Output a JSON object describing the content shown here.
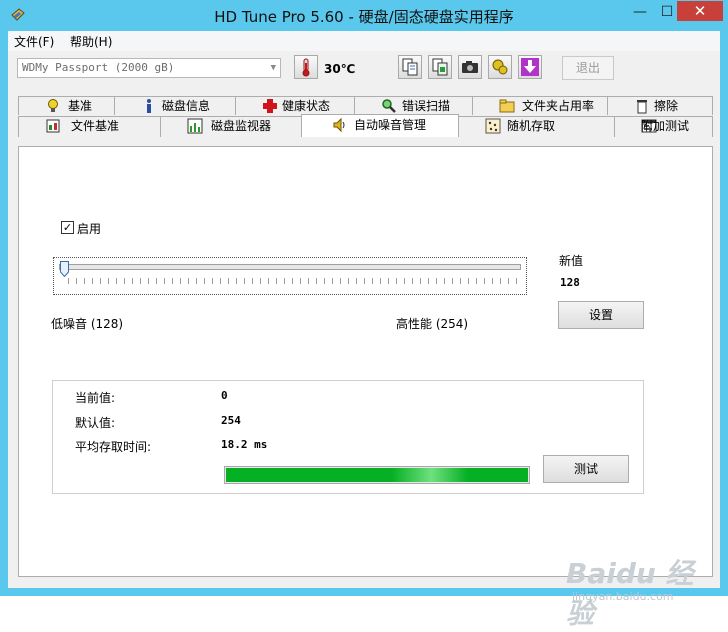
{
  "window": {
    "title": "HD Tune Pro 5.60 - 硬盘/固态硬盘实用程序",
    "minimize_glyph": "—",
    "maximize_glyph": "☐",
    "close_glyph": "✕"
  },
  "menu": {
    "file": "文件(F)",
    "help": "帮助(H)"
  },
  "toolbar": {
    "drive": "WDMy Passport (2000 gB)",
    "temperature": "30℃",
    "icons": [
      "copy-icon",
      "copy-compare-icon",
      "camera-icon",
      "gear-coins-icon",
      "download-arrow-icon"
    ],
    "exit_label": "退出"
  },
  "tabs": {
    "row1": [
      {
        "label": "基准",
        "icon": "lightbulb-icon"
      },
      {
        "label": "磁盘信息",
        "icon": "info-icon"
      },
      {
        "label": "健康状态",
        "icon": "red-cross-icon"
      },
      {
        "label": "错误扫描",
        "icon": "magnifier-icon"
      },
      {
        "label": "文件夹占用率",
        "icon": "folder-icon"
      },
      {
        "label": "擦除",
        "icon": "trash-icon"
      }
    ],
    "row2": [
      {
        "label": "文件基准",
        "icon": "file-benchmark-icon"
      },
      {
        "label": "磁盘监视器",
        "icon": "chart-icon"
      },
      {
        "label": "自动噪音管理",
        "icon": "speaker-icon",
        "active": true
      },
      {
        "label": "随机存取",
        "icon": "random-dots-icon"
      },
      {
        "label": "附加测试",
        "icon": "window-test-icon"
      }
    ]
  },
  "aam": {
    "enable_label": "启用",
    "enabled": true,
    "new_value_label": "新值",
    "new_value": "128",
    "low_noise_label": "低噪音 (128)",
    "high_perf_label": "高性能 (254)",
    "slider_value": 128,
    "slider_min": 128,
    "slider_max": 254,
    "set_button": "设置",
    "current_label": "当前值:",
    "current_value": "0",
    "default_label": "默认值:",
    "default_value": "254",
    "access_time_label": "平均存取时间:",
    "access_time_value": "18.2 ms",
    "progress": 1.0,
    "test_button": "测试"
  },
  "watermark": {
    "brand": "Baidu 经验",
    "url": "jingyan.baidu.com"
  }
}
